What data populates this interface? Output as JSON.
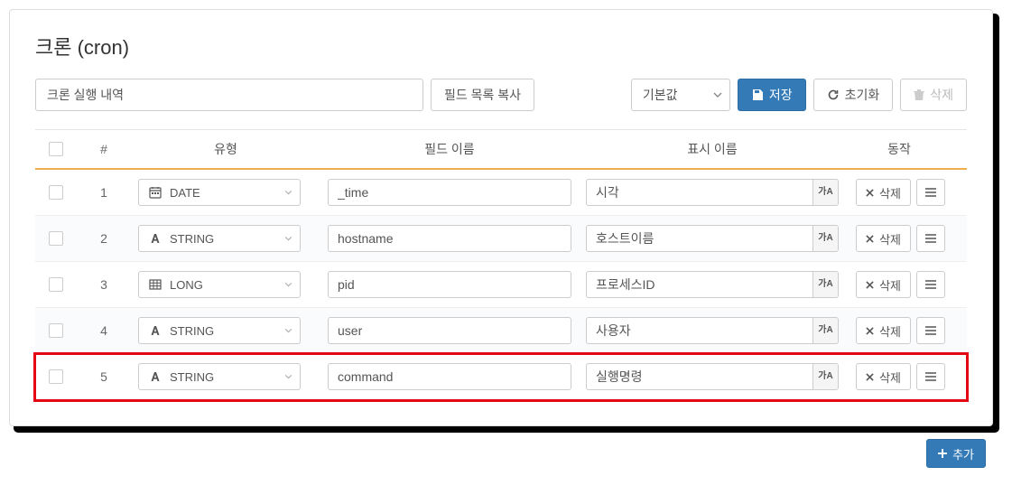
{
  "title": "크론 (cron)",
  "toolbar": {
    "name_value": "크론 실행 내역",
    "copy_fields": "필드 목록 복사",
    "preset_selected": "기본값",
    "save": "저장",
    "reset": "초기화",
    "delete": "삭제"
  },
  "columns": {
    "index": "#",
    "type": "유형",
    "field": "필드 이름",
    "display": "표시 이름",
    "action": "동작"
  },
  "type_labels": {
    "DATE": "DATE",
    "STRING": "STRING",
    "LONG": "LONG"
  },
  "rows": [
    {
      "idx": "1",
      "type": "DATE",
      "field": "_time",
      "display": "시각",
      "highlight": false
    },
    {
      "idx": "2",
      "type": "STRING",
      "field": "hostname",
      "display": "호스트이름",
      "highlight": false
    },
    {
      "idx": "3",
      "type": "LONG",
      "field": "pid",
      "display": "프로세스ID",
      "highlight": false
    },
    {
      "idx": "4",
      "type": "STRING",
      "field": "user",
      "display": "사용자",
      "highlight": false
    },
    {
      "idx": "5",
      "type": "STRING",
      "field": "command",
      "display": "실행명령",
      "highlight": true
    }
  ],
  "row_actions": {
    "delete": "삭제"
  },
  "footer": {
    "add": "추가"
  },
  "icons": {
    "lang": "가A"
  }
}
